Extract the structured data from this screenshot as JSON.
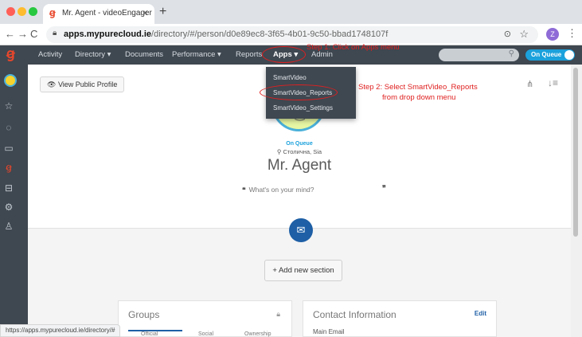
{
  "browser": {
    "tab_title": "Mr. Agent - videoEngager",
    "tab_logo": "ꞡ",
    "url_host": "apps.mypurecloud.ie",
    "url_path": "/directory/#/person/d0e89ec8-3f65-4b01-9c50-bbad1748107f",
    "profile_initial": "Z",
    "status_url": "https://apps.mypurecloud.ie/directory/#"
  },
  "header": {
    "logo": "ꞡ",
    "nav": [
      {
        "label": "Activity"
      },
      {
        "label": "Directory ▾"
      },
      {
        "label": "Documents"
      },
      {
        "label": "Performance ▾"
      },
      {
        "label": "Reports"
      },
      {
        "label": "Apps ▾"
      },
      {
        "label": "Admin"
      }
    ],
    "status": "On Queue"
  },
  "apps_menu": {
    "items": [
      {
        "label": "SmartVideo"
      },
      {
        "label": "SmartVideo_Reports"
      },
      {
        "label": "SmartVideo_Settings"
      }
    ]
  },
  "profile": {
    "view_public_profile": "View Public Profile",
    "presence": "On Queue",
    "location": "Столична, Sia",
    "name": "Mr. Agent",
    "mind_placeholder": "What's on your mind?",
    "quote_open": "❝",
    "quote_close": "❞",
    "add_section": "+ Add new section"
  },
  "cards": {
    "groups_title": "Groups",
    "group_tabs": [
      "Official",
      "Social",
      "Ownership"
    ],
    "contact_title": "Contact Information",
    "contact_edit": "Edit",
    "contact_first_field": "Main Email"
  },
  "annotations": {
    "step1": "Step 1: Click on Apps menu",
    "step2_line1": "Step 2: Select SmartVideo_Reports",
    "step2_line2": "from drop down menu",
    "color": "#e02020"
  },
  "icons": {
    "sidebar": [
      "star-icon",
      "chat-icon",
      "video-icon",
      "logo-icon",
      "inbox-icon",
      "settings-icon",
      "person-icon"
    ]
  }
}
